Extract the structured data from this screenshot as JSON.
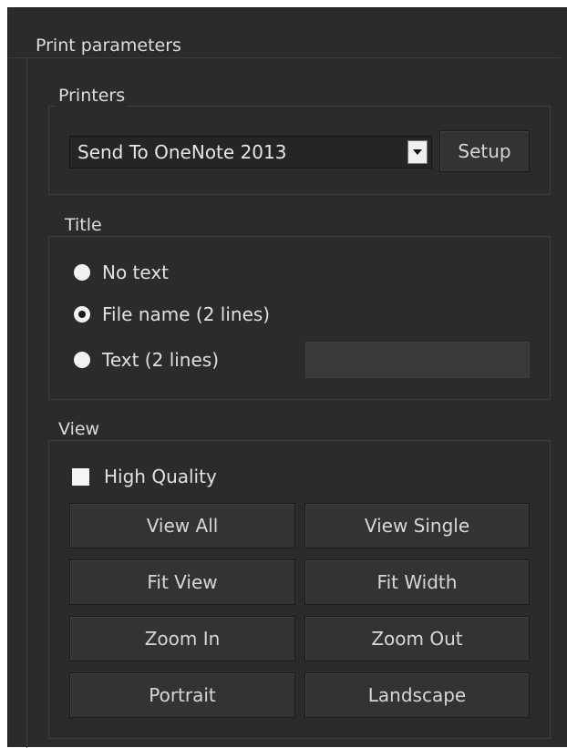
{
  "print_parameters": {
    "label": "Print parameters"
  },
  "printers": {
    "label": "Printers",
    "selected": "Send To OneNote 2013",
    "setup_label": "Setup"
  },
  "title_group": {
    "label": "Title",
    "options": [
      {
        "label": "No text",
        "checked": false
      },
      {
        "label": "File name (2 lines)",
        "checked": true
      },
      {
        "label": "Text (2 lines)",
        "checked": false
      }
    ],
    "text_value": ""
  },
  "view": {
    "label": "View",
    "high_quality_label": "High Quality",
    "high_quality_checked": false,
    "buttons": [
      "View All",
      "View Single",
      "Fit View",
      "Fit Width",
      "Zoom In",
      "Zoom Out",
      "Portrait",
      "Landscape"
    ]
  },
  "colors": {
    "background": "#2b2b2b",
    "text": "#e0e0e0",
    "button": "#333333",
    "border": "#3d3d3d"
  }
}
